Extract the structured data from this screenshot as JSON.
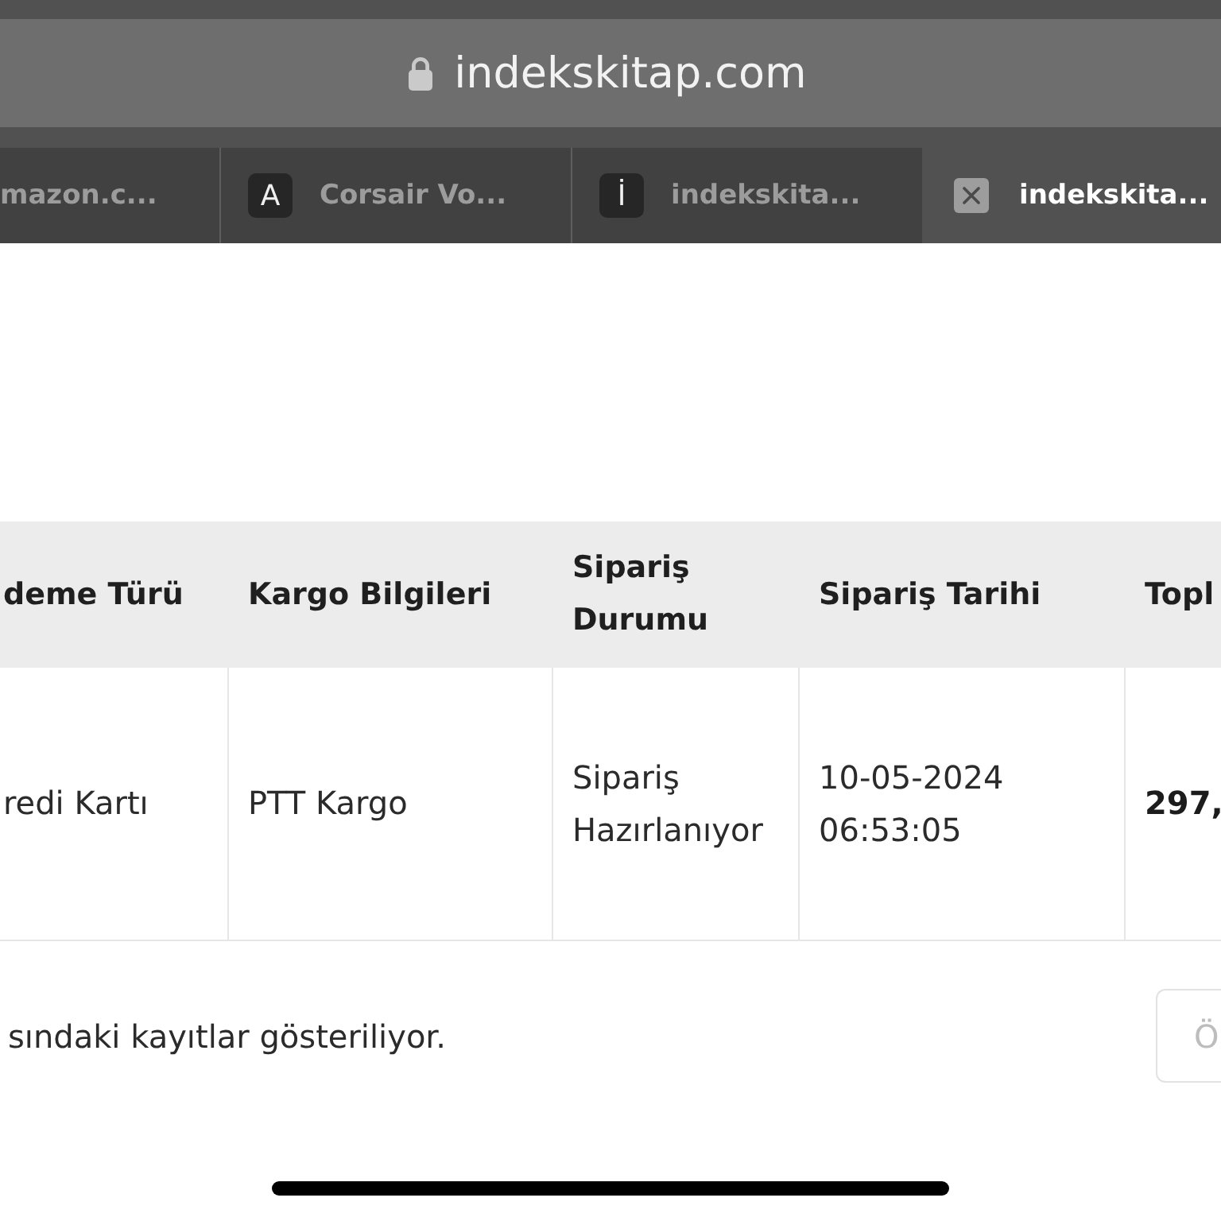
{
  "address_bar": {
    "url": "indekskitap.com",
    "secure": true
  },
  "tabs": [
    {
      "title": "mazon.c...",
      "selected": false
    },
    {
      "title": "Corsair Vo...",
      "favicon": "A",
      "selected": false
    },
    {
      "title": "indekskita...",
      "favicon": "İ",
      "selected": false
    },
    {
      "title": "indekskita...",
      "selected": true
    }
  ],
  "table": {
    "columns": [
      "deme Türü",
      "Kargo Bilgileri",
      "Sipariş Durumu",
      "Sipariş Tarihi",
      "Topl"
    ],
    "rows": [
      [
        "redi Kartı",
        "PTT Kargo",
        "Sipariş Hazırlanıyor",
        "10-05-2024 06:53:05",
        "297,"
      ]
    ]
  },
  "footer": {
    "summary": "sındaki kayıtlar gösteriliyor.",
    "pager_button": "Ö"
  }
}
